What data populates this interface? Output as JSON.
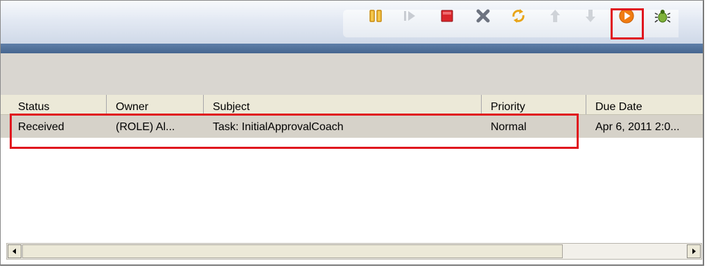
{
  "toolbar": {
    "buttons": [
      {
        "name": "pause",
        "icon": "pause-icon",
        "enabled": true
      },
      {
        "name": "step",
        "icon": "step-icon",
        "enabled": false
      },
      {
        "name": "stop",
        "icon": "stop-icon",
        "enabled": true
      },
      {
        "name": "cancel",
        "icon": "close-icon",
        "enabled": true
      },
      {
        "name": "refresh",
        "icon": "refresh-icon",
        "enabled": true
      },
      {
        "name": "move-up",
        "icon": "arrow-up-icon",
        "enabled": false
      },
      {
        "name": "move-down",
        "icon": "arrow-down-icon",
        "enabled": false
      },
      {
        "name": "run",
        "icon": "run-icon",
        "enabled": true,
        "highlighted": true
      },
      {
        "name": "debug",
        "icon": "bug-icon",
        "enabled": true
      }
    ],
    "colors": {
      "pause": "#e8a417",
      "stop": "#d9262b",
      "run": "#f07c12",
      "highlight": "#e0141d"
    }
  },
  "table": {
    "columns": [
      "Status",
      "Owner",
      "Subject",
      "Priority",
      "Due Date"
    ],
    "rows": [
      {
        "status": "Received",
        "owner": "(ROLE) Al...",
        "subject": "Task: InitialApprovalCoach",
        "priority": "Normal",
        "due_date": "Apr 6, 2011 2:0..."
      }
    ]
  }
}
